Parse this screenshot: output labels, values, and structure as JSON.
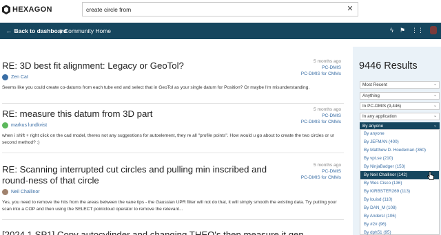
{
  "header": {
    "logo_text": "HEXAGON",
    "search_value": "create circle from",
    "clear_icon": "close-icon"
  },
  "navbar": {
    "back_label": "Back to dashboard",
    "separator": "|",
    "home_label": "Community Home",
    "icons": [
      "bolt-icon",
      "flag-icon",
      "grid-icon",
      "avatar"
    ]
  },
  "results": [
    {
      "title": "RE: 3D best fit alignment: Legacy or GeoTol?",
      "author": "Zen Cat",
      "avatar_color": "#3a6ea5",
      "excerpt": "Seems like you could create co-datums from each tube end and select that in GeoTol as your single datum for Position? Or maybe I'm misunderstanding.",
      "ago": "5 months ago",
      "tags": [
        "PC-DMIS",
        "PC-DMIS for CMMs"
      ]
    },
    {
      "title": "RE: measure this datum from 3D part",
      "author": "markus lundkvist",
      "avatar_color": "#5cb85c",
      "excerpt": "when i shift + right click on the cad model, theres not any suggestions for autoelement, they re all \"profile points\". How would u go about to create the two circles or ur second method? :)",
      "ago": "5 months ago",
      "tags": [
        "PC-DMIS",
        "PC-DMIS for CMMs"
      ]
    },
    {
      "title": "RE: Scanning interrupted cut circles and pulling min inscribed and round-ness of that circle",
      "author": "Neil Challinor",
      "avatar_color": "#a0826d",
      "excerpt": "Yes, you need to remove the hits from the areas between the vane tips - the Gaussian UPR filter will not do that, it will simply smooth the existing data. Try putting your scan into a COP and then using the SELECT pointcloud operator to remove the relevant...",
      "ago": "5 months ago",
      "tags": [
        "PC-DMIS",
        "PC-DMIS for CMMs"
      ]
    },
    {
      "title": "[2024.1 SP1] Copy autocylinder and changing THEO's then measure it gen",
      "author": "",
      "avatar_color": "",
      "excerpt": "",
      "ago": "",
      "tags": []
    }
  ],
  "panel": {
    "count_text": "9446 Results",
    "selects": [
      "Most Recent",
      "Anything",
      "In PC-DMIS (9,446)",
      "In any application",
      "By anyone"
    ],
    "options": [
      "By anyone",
      "By JEFMAN (400)",
      "By Matthew D. Hoedeman (360)",
      "By vpt.se (210)",
      "By NinjaBadger (153)",
      "By Neil Challinor (142)",
      "By Wes Cisco (136)",
      "By KIRBSTER269 (113)",
      "By louisd (110)",
      "By DAN_M (108)",
      "By AndersI (106)",
      "By #2# (96)",
      "By dph51 (95)"
    ],
    "highlighted_option": "By Neil Challinor (142)"
  },
  "colors": {
    "navbar": "#16465e",
    "link": "#3a6ea5",
    "panel_bg": "#eaf2f8"
  }
}
